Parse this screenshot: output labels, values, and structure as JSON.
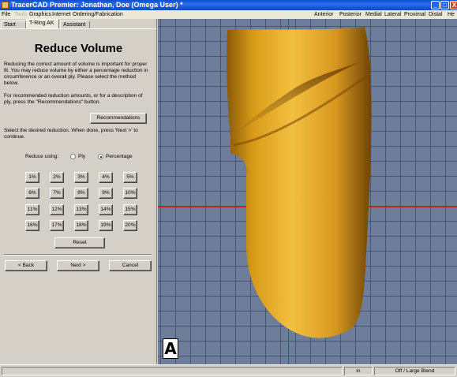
{
  "window": {
    "title": "TracerCAD Premier:  Jonathan, Doe  (Omega User) *",
    "minimize_glyph": "_",
    "maximize_glyph": "□",
    "close_glyph": "X"
  },
  "menu": {
    "left": [
      "File",
      "Tools",
      "Graphics",
      "Internet",
      "Ordering/Fabrication"
    ],
    "right": [
      "Anterior",
      "Posterior",
      "Medial",
      "Lateral",
      "Proximal",
      "Distal",
      "He"
    ]
  },
  "tabs": [
    "Start",
    "T-Ring AK",
    "Assistant"
  ],
  "panel": {
    "title": "Reduce Volume",
    "intro": "Reducing the correct amount of volume is important for proper fit. You may reduce volume by either a percentage reduction in circumference or an overall ply. Please select the method below.",
    "recommend_text": "For recommended reduction amounts, or for a description of ply, press the \"Recommendations\" button.",
    "recommendations_label": "Recommendations",
    "select_text": "Select the desired reduction. When done, press 'Next >' to continue.",
    "reduce_using_label": "Reduce using:",
    "option_ply": "Ply",
    "option_percentage": "Percentage",
    "selected_option": "Percentage",
    "percent_buttons": [
      "1%",
      "2%",
      "3%",
      "4%",
      "5%",
      "6%",
      "7%",
      "8%",
      "9%",
      "10%",
      "11%",
      "12%",
      "13%",
      "14%",
      "15%",
      "16%",
      "17%",
      "18%",
      "19%",
      "20%"
    ],
    "reset_label": "Reset",
    "back_label": "< Back",
    "next_label": "Next >",
    "cancel_label": "Cancel"
  },
  "viewport": {
    "view_label": "A",
    "background_color": "#6e7d99",
    "model_color": "#e0a020"
  },
  "status": {
    "unit": "in",
    "blend": "Off / Large Blend"
  }
}
